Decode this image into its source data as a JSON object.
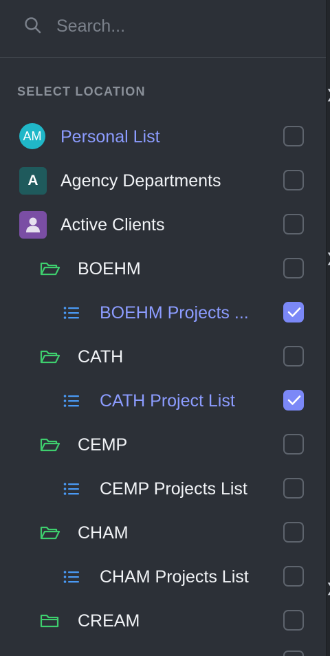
{
  "search": {
    "placeholder": "Search..."
  },
  "section_label": "SELECT LOCATION",
  "items": [
    {
      "label": "Personal List",
      "icon": "avatar-initials",
      "initials": "AM",
      "selected": true,
      "checked": false
    },
    {
      "label": "Agency Departments",
      "icon": "avatar-letter",
      "initials": "A",
      "selected": false,
      "checked": false
    },
    {
      "label": "Active Clients",
      "icon": "avatar-user-icon",
      "selected": false,
      "checked": false
    },
    {
      "label": "BOEHM",
      "icon": "folder-open-icon",
      "selected": false,
      "checked": false
    },
    {
      "label": "BOEHM Projects ...",
      "icon": "list-icon",
      "selected": true,
      "checked": true
    },
    {
      "label": "CATH",
      "icon": "folder-open-icon",
      "selected": false,
      "checked": false
    },
    {
      "label": "CATH Project List",
      "icon": "list-icon",
      "selected": true,
      "checked": true
    },
    {
      "label": "CEMP",
      "icon": "folder-open-icon",
      "selected": false,
      "checked": false
    },
    {
      "label": "CEMP Projects List",
      "icon": "list-icon",
      "selected": false,
      "checked": false
    },
    {
      "label": "CHAM",
      "icon": "folder-open-icon",
      "selected": false,
      "checked": false
    },
    {
      "label": "CHAM Projects List",
      "icon": "list-icon",
      "selected": false,
      "checked": false
    },
    {
      "label": "CREAM",
      "icon": "folder-closed-icon",
      "selected": false,
      "checked": false
    }
  ],
  "colors": {
    "background": "#2c3037",
    "selected_text": "#8c9cff",
    "checkbox_checked": "#7b88f7",
    "folder_icon": "#3ecf6e",
    "list_icon": "#4a9af5",
    "avatar_initials": "#20b7c8",
    "avatar_letter": "#1f5a5c",
    "avatar_user": "#7a4ea4"
  }
}
